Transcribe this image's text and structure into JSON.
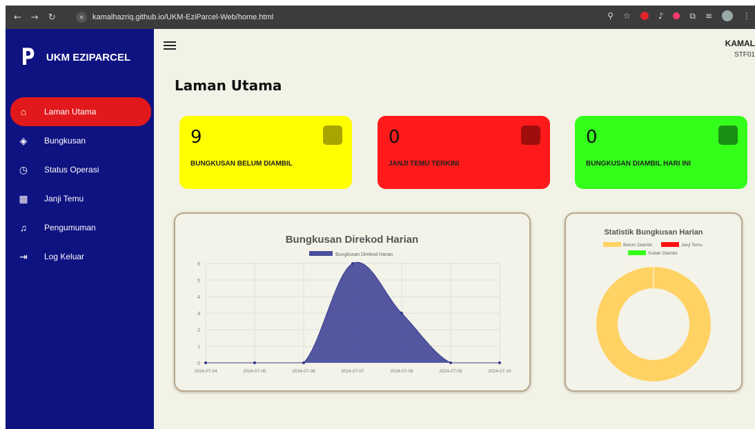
{
  "browser": {
    "back_icon": "arrow-left-icon",
    "url": "kamalhazriq.github.io/UKM-EziParcel-Web/home.html"
  },
  "brand": {
    "logo": "P",
    "name": "UKM EZIPARCEL"
  },
  "menu": [
    {
      "label": "Laman Utama",
      "icon": "home-icon",
      "glyph": "⌂",
      "active": true
    },
    {
      "label": "Bungkusan",
      "icon": "package-icon",
      "glyph": "◈",
      "active": false
    },
    {
      "label": "Status Operasi",
      "icon": "clock-icon",
      "glyph": "◷",
      "active": false
    },
    {
      "label": "Janji Temu",
      "icon": "calendar-icon",
      "glyph": "▦",
      "active": false
    },
    {
      "label": "Pengumuman",
      "icon": "bell-icon",
      "glyph": "♫",
      "active": false
    },
    {
      "label": "Log Keluar",
      "icon": "logout-icon",
      "glyph": "⇥",
      "active": false
    }
  ],
  "user": {
    "name": "KAMAL",
    "id": "STF01"
  },
  "page": {
    "title": "Laman Utama"
  },
  "cards": [
    {
      "value": "9",
      "label": "BUNGKUSAN BELUM DIAMBIL",
      "color": "#ffff00",
      "icon": "box-icon",
      "icon_color": "#a8a400"
    },
    {
      "value": "0",
      "label": "JANJI TEMU TERKINI",
      "color": "#fe1a1a",
      "icon": "calendar-icon",
      "icon_color": "#a00d0d"
    },
    {
      "value": "0",
      "label": "BUNGKUSAN DIAMBIL HARI INI",
      "color": "#33ff1a",
      "icon": "shopping-bag-icon",
      "icon_color": "#1a8f12"
    }
  ],
  "chart_data": [
    {
      "type": "area",
      "title": "Bungkusan Direkod Harian",
      "legend": [
        "Bungkusan Direkod Harian"
      ],
      "legend_position": "top",
      "x": [
        "2024-07-04",
        "2024-07-05",
        "2024-07-06",
        "2024-07-07",
        "2024-07-08",
        "2024-07-09",
        "2024-07-10"
      ],
      "series": [
        {
          "name": "Bungkusan Direkod Harian",
          "values": [
            0,
            0,
            0,
            6,
            3,
            0,
            0
          ],
          "color": "#4a4e9c"
        }
      ],
      "ylim": [
        0,
        6
      ],
      "yticks": [
        "0",
        "1",
        "2",
        "3",
        "4",
        "5",
        "6"
      ],
      "grid": true
    },
    {
      "type": "pie",
      "title": "Statistik Bungkusan Harian",
      "legend": [
        "Belum Diambil",
        "Janji Temu",
        "Sudah Diambil"
      ],
      "legend_position": "top",
      "labels": [
        "Belum Diambil",
        "Janji Temu",
        "Sudah Diambil"
      ],
      "values": [
        9,
        0,
        0
      ],
      "colors": [
        "#ffd264",
        "#ff1010",
        "#33ff1a"
      ]
    }
  ]
}
